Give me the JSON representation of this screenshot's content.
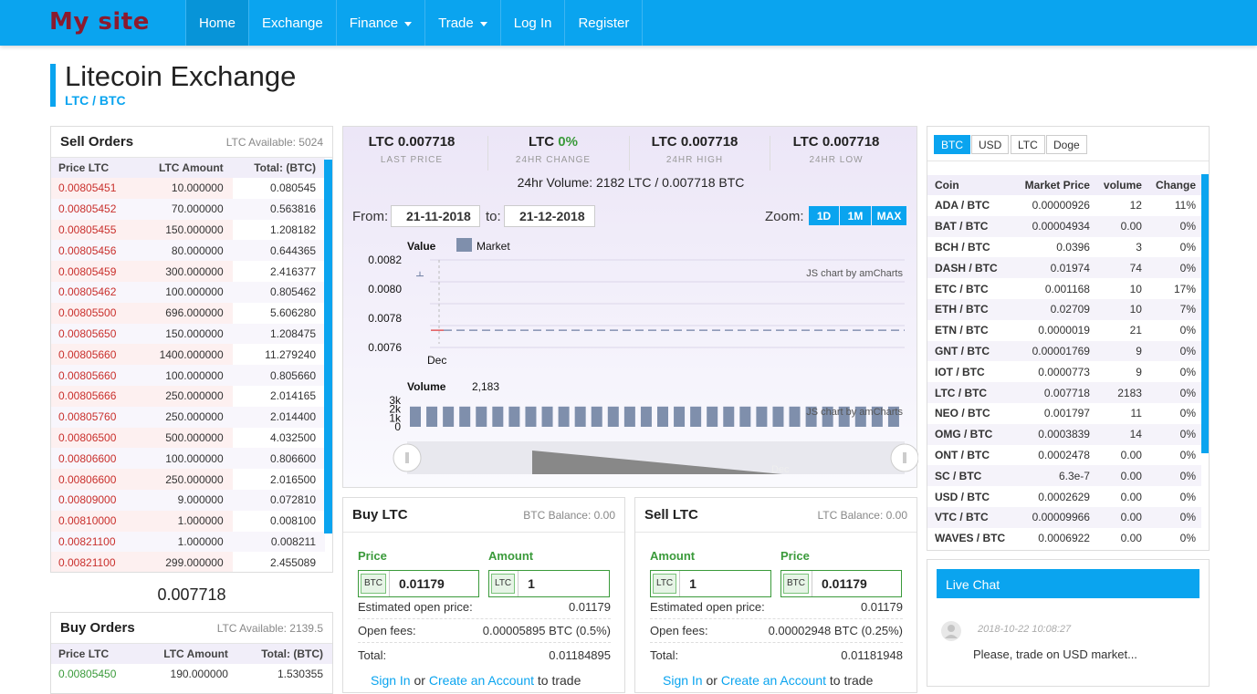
{
  "brand": "My site",
  "nav": [
    {
      "label": "Home",
      "active": true,
      "dropdown": false
    },
    {
      "label": "Exchange",
      "active": false,
      "dropdown": false
    },
    {
      "label": "Finance",
      "active": false,
      "dropdown": true
    },
    {
      "label": "Trade",
      "active": false,
      "dropdown": true
    },
    {
      "label": "Log In",
      "active": false,
      "dropdown": false
    },
    {
      "label": "Register",
      "active": false,
      "dropdown": false
    }
  ],
  "page": {
    "title": "Litecoin Exchange",
    "subtitle": "LTC / BTC"
  },
  "sell_orders": {
    "title": "Sell Orders",
    "available": "LTC Available: 5024",
    "headers": [
      "Price LTC",
      "LTC Amount",
      "Total: (BTC)"
    ],
    "rows": [
      [
        "0.00805451",
        "10.000000",
        "0.080545"
      ],
      [
        "0.00805452",
        "70.000000",
        "0.563816"
      ],
      [
        "0.00805455",
        "150.000000",
        "1.208182"
      ],
      [
        "0.00805456",
        "80.000000",
        "0.644365"
      ],
      [
        "0.00805459",
        "300.000000",
        "2.416377"
      ],
      [
        "0.00805462",
        "100.000000",
        "0.805462"
      ],
      [
        "0.00805500",
        "696.000000",
        "5.606280"
      ],
      [
        "0.00805650",
        "150.000000",
        "1.208475"
      ],
      [
        "0.00805660",
        "1400.000000",
        "11.279240"
      ],
      [
        "0.00805660",
        "100.000000",
        "0.805660"
      ],
      [
        "0.00805666",
        "250.000000",
        "2.014165"
      ],
      [
        "0.00805760",
        "250.000000",
        "2.014400"
      ],
      [
        "0.00806500",
        "500.000000",
        "4.032500"
      ],
      [
        "0.00806600",
        "100.000000",
        "0.806600"
      ],
      [
        "0.00806600",
        "250.000000",
        "2.016500"
      ],
      [
        "0.00809000",
        "9.000000",
        "0.072810"
      ],
      [
        "0.00810000",
        "1.000000",
        "0.008100"
      ],
      [
        "0.00821100",
        "1.000000",
        "0.008211"
      ],
      [
        "0.00821100",
        "299.000000",
        "2.455089"
      ]
    ]
  },
  "last_price_mid": "0.007718",
  "buy_orders": {
    "title": "Buy Orders",
    "available": "LTC Available: 2139.5",
    "headers": [
      "Price LTC",
      "LTC Amount",
      "Total: (BTC)"
    ],
    "rows": [
      [
        "0.00805450",
        "190.000000",
        "1.530355"
      ]
    ]
  },
  "stats": [
    {
      "cur": "LTC",
      "value": "0.007718",
      "label": "LAST PRICE",
      "color": "#222222"
    },
    {
      "cur": "LTC",
      "value": "0%",
      "label": "24HR CHANGE",
      "color": "#3a9a3a"
    },
    {
      "cur": "LTC",
      "value": "0.007718",
      "label": "24HR HIGH",
      "color": "#222222"
    },
    {
      "cur": "LTC",
      "value": "0.007718",
      "label": "24HR LOW",
      "color": "#222222"
    }
  ],
  "volume_line": "24hr Volume: 2182 LTC / 0.007718 BTC",
  "range": {
    "from_label": "From:",
    "from": "21-11-2018",
    "to_label": "to:",
    "to": "21-12-2018",
    "zoom_label": "Zoom:",
    "zoom": [
      "1D",
      "1M",
      "MAX"
    ]
  },
  "chart_data": [
    {
      "type": "line",
      "title": "Value",
      "legend": [
        "Market"
      ],
      "watermark": "JS chart by amCharts",
      "y_ticks": [
        "0.0082",
        "0.0080",
        "0.0078",
        "0.0076"
      ],
      "x_ticks": [
        "Dec"
      ],
      "ylim": [
        0.0076,
        0.0082
      ],
      "series": [
        {
          "name": "Market",
          "values": [
            0.007718
          ]
        }
      ]
    },
    {
      "type": "bar",
      "title": "Volume",
      "readout": "2,183",
      "watermark": "JS chart by amCharts",
      "y_ticks": [
        "3k",
        "2k",
        "1k",
        "0"
      ],
      "scroll_label": "Dec",
      "values": [
        2183,
        2183,
        2183,
        2183,
        2183,
        2183,
        2183,
        2183,
        2183,
        2183,
        2183,
        2183,
        2183,
        2183,
        2183,
        2183,
        2183,
        2183,
        2183,
        2183,
        2183,
        2183,
        2183,
        2183,
        2183,
        2183,
        2183,
        2183,
        2183,
        2183
      ]
    }
  ],
  "market": {
    "tabs": [
      "BTC",
      "USD",
      "LTC",
      "Doge"
    ],
    "headers": [
      "Coin",
      "Market Price",
      "volume",
      "Change"
    ],
    "rows": [
      [
        "ADA / BTC",
        "0.00000926",
        "12",
        "11%",
        "up"
      ],
      [
        "BAT / BTC",
        "0.00004934",
        "0.00",
        "0%",
        ""
      ],
      [
        "BCH / BTC",
        "0.0396",
        "3",
        "0%",
        ""
      ],
      [
        "DASH / BTC",
        "0.01974",
        "74",
        "0%",
        ""
      ],
      [
        "ETC / BTC",
        "0.001168",
        "10",
        "17%",
        "up"
      ],
      [
        "ETH / BTC",
        "0.02709",
        "10",
        "7%",
        "up"
      ],
      [
        "ETN / BTC",
        "0.0000019",
        "21",
        "0%",
        ""
      ],
      [
        "GNT / BTC",
        "0.00001769",
        "9",
        "0%",
        ""
      ],
      [
        "IOT / BTC",
        "0.0000773",
        "9",
        "0%",
        ""
      ],
      [
        "LTC / BTC",
        "0.007718",
        "2183",
        "0%",
        ""
      ],
      [
        "NEO / BTC",
        "0.001797",
        "11",
        "0%",
        ""
      ],
      [
        "OMG / BTC",
        "0.0003839",
        "14",
        "0%",
        "dn"
      ],
      [
        "ONT / BTC",
        "0.0002478",
        "0.00",
        "0%",
        ""
      ],
      [
        "SC / BTC",
        "6.3e-7",
        "0.00",
        "0%",
        ""
      ],
      [
        "USD / BTC",
        "0.0002629",
        "0.00",
        "0%",
        ""
      ],
      [
        "VTC / BTC",
        "0.00009966",
        "0.00",
        "0%",
        ""
      ],
      [
        "WAVES / BTC",
        "0.0006922",
        "0.00",
        "0%",
        ""
      ]
    ]
  },
  "buy_form": {
    "title": "Buy LTC",
    "balance": "BTC Balance: 0.00",
    "label1": "Price",
    "cur1": "BTC",
    "val1": "0.01179",
    "label2": "Amount",
    "cur2": "LTC",
    "val2": "1",
    "est_label": "Estimated open price:",
    "est_val": "0.01179",
    "fee_label": "Open fees:",
    "fee_val": "0.00005895 BTC (0.5%)",
    "total_label": "Total:",
    "total_val": "0.01184895",
    "signin": "Sign In",
    "or": "or",
    "create": "Create an Account",
    "trade": "to trade"
  },
  "sell_form": {
    "title": "Sell LTC",
    "balance": "LTC Balance: 0.00",
    "label1": "Amount",
    "cur1": "LTC",
    "val1": "1",
    "label2": "Price",
    "cur2": "BTC",
    "val2": "0.01179",
    "est_label": "Estimated open price:",
    "est_val": "0.01179",
    "fee_label": "Open fees:",
    "fee_val": "0.00002948 BTC (0.25%)",
    "total_label": "Total:",
    "total_val": "0.01181948",
    "signin": "Sign In",
    "or": "or",
    "create": "Create an Account",
    "trade": "to trade"
  },
  "chat": {
    "title": "Live Chat",
    "messages": [
      {
        "time": "2018-10-22 10:08:27",
        "text": "Please, trade on USD market..."
      }
    ]
  },
  "colors": {
    "accent": "#0aa4ef",
    "sell": "#c9302c",
    "buy": "#3a9a3a",
    "brand": "#8b1a2e"
  }
}
